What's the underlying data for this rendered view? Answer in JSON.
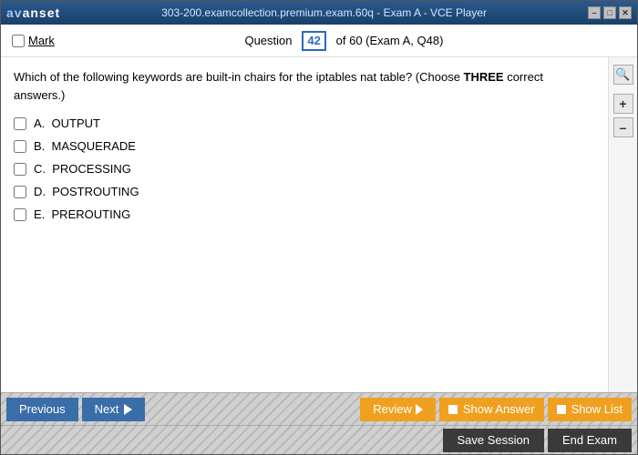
{
  "window": {
    "title": "303-200.examcollection.premium.exam.60q - Exam A - VCE Player",
    "controls": {
      "minimize": "–",
      "maximize": "□",
      "close": "✕"
    }
  },
  "logo": {
    "part1": "av",
    "part2": "anset"
  },
  "question_header": {
    "mark_label": "Mark",
    "question_label": "Question",
    "question_number": "42",
    "question_total": "of 60 (Exam A, Q48)"
  },
  "question": {
    "text": "Which of the following keywords are built-in chairs for the iptables nat table? (Choose ",
    "bold_text": "THREE",
    "text_suffix": " correct answers.)",
    "options": [
      {
        "id": "A",
        "label": "A.  OUTPUT"
      },
      {
        "id": "B",
        "label": "B.  MASQUERADE"
      },
      {
        "id": "C",
        "label": "C.  PROCESSING"
      },
      {
        "id": "D",
        "label": "D.  POSTROUTING"
      },
      {
        "id": "E",
        "label": "E.  PREROUTING"
      }
    ]
  },
  "navigation": {
    "previous_label": "Previous",
    "next_label": "Next",
    "review_label": "Review",
    "show_answer_label": "Show Answer",
    "show_list_label": "Show List",
    "save_session_label": "Save Session",
    "end_exam_label": "End Exam"
  },
  "zoom": {
    "plus": "+",
    "minus": "–",
    "search": "🔍"
  }
}
